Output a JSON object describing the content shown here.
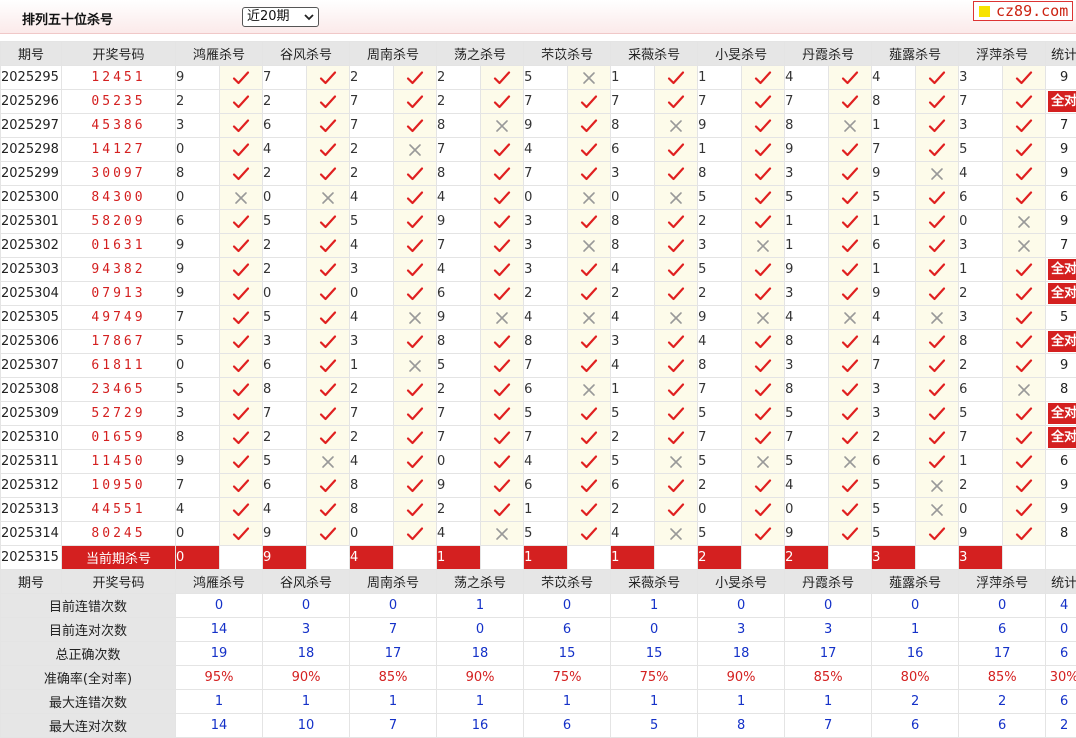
{
  "header": {
    "title": "排列五十位杀号",
    "period_select": "近20期",
    "logo": "cz89.com"
  },
  "columns": {
    "issue": "期号",
    "numbers": "开奖号码",
    "experts": [
      "鸿雁杀号",
      "谷风杀号",
      "周南杀号",
      "荡之杀号",
      "芣苡杀号",
      "采薇杀号",
      "小旻杀号",
      "丹霞杀号",
      "薤露杀号",
      "浮萍杀号"
    ],
    "stat": "统计"
  },
  "rows": [
    {
      "issue": "2025295",
      "numbers": "12451",
      "picks": [
        [
          9,
          1
        ],
        [
          7,
          1
        ],
        [
          2,
          1
        ],
        [
          2,
          1
        ],
        [
          5,
          0
        ],
        [
          1,
          1
        ],
        [
          1,
          1
        ],
        [
          4,
          1
        ],
        [
          4,
          1
        ],
        [
          3,
          1
        ]
      ],
      "stat": "9"
    },
    {
      "issue": "2025296",
      "numbers": "05235",
      "picks": [
        [
          2,
          1
        ],
        [
          2,
          1
        ],
        [
          7,
          1
        ],
        [
          2,
          1
        ],
        [
          7,
          1
        ],
        [
          7,
          1
        ],
        [
          7,
          1
        ],
        [
          7,
          1
        ],
        [
          8,
          1
        ],
        [
          7,
          1
        ]
      ],
      "stat": "全对"
    },
    {
      "issue": "2025297",
      "numbers": "45386",
      "picks": [
        [
          3,
          1
        ],
        [
          6,
          1
        ],
        [
          7,
          1
        ],
        [
          8,
          0
        ],
        [
          9,
          1
        ],
        [
          8,
          0
        ],
        [
          9,
          1
        ],
        [
          8,
          0
        ],
        [
          1,
          1
        ],
        [
          3,
          1
        ]
      ],
      "stat": "7"
    },
    {
      "issue": "2025298",
      "numbers": "14127",
      "picks": [
        [
          0,
          1
        ],
        [
          4,
          1
        ],
        [
          2,
          0
        ],
        [
          7,
          1
        ],
        [
          4,
          1
        ],
        [
          6,
          1
        ],
        [
          1,
          1
        ],
        [
          9,
          1
        ],
        [
          7,
          1
        ],
        [
          5,
          1
        ]
      ],
      "stat": "9"
    },
    {
      "issue": "2025299",
      "numbers": "30097",
      "picks": [
        [
          8,
          1
        ],
        [
          2,
          1
        ],
        [
          2,
          1
        ],
        [
          8,
          1
        ],
        [
          7,
          1
        ],
        [
          3,
          1
        ],
        [
          8,
          1
        ],
        [
          3,
          1
        ],
        [
          9,
          0
        ],
        [
          4,
          1
        ]
      ],
      "stat": "9"
    },
    {
      "issue": "2025300",
      "numbers": "84300",
      "picks": [
        [
          0,
          0
        ],
        [
          0,
          0
        ],
        [
          4,
          1
        ],
        [
          4,
          1
        ],
        [
          0,
          0
        ],
        [
          0,
          0
        ],
        [
          5,
          1
        ],
        [
          5,
          1
        ],
        [
          5,
          1
        ],
        [
          6,
          1
        ]
      ],
      "stat": "6"
    },
    {
      "issue": "2025301",
      "numbers": "58209",
      "picks": [
        [
          6,
          1
        ],
        [
          5,
          1
        ],
        [
          5,
          1
        ],
        [
          9,
          1
        ],
        [
          3,
          1
        ],
        [
          8,
          1
        ],
        [
          2,
          1
        ],
        [
          1,
          1
        ],
        [
          1,
          1
        ],
        [
          0,
          0
        ]
      ],
      "stat": "9"
    },
    {
      "issue": "2025302",
      "numbers": "01631",
      "picks": [
        [
          9,
          1
        ],
        [
          2,
          1
        ],
        [
          4,
          1
        ],
        [
          7,
          1
        ],
        [
          3,
          0
        ],
        [
          8,
          1
        ],
        [
          3,
          0
        ],
        [
          1,
          1
        ],
        [
          6,
          1
        ],
        [
          3,
          0
        ]
      ],
      "stat": "7"
    },
    {
      "issue": "2025303",
      "numbers": "94382",
      "picks": [
        [
          9,
          1
        ],
        [
          2,
          1
        ],
        [
          3,
          1
        ],
        [
          4,
          1
        ],
        [
          3,
          1
        ],
        [
          4,
          1
        ],
        [
          5,
          1
        ],
        [
          9,
          1
        ],
        [
          1,
          1
        ],
        [
          1,
          1
        ]
      ],
      "stat": "全对"
    },
    {
      "issue": "2025304",
      "numbers": "07913",
      "picks": [
        [
          9,
          1
        ],
        [
          0,
          1
        ],
        [
          0,
          1
        ],
        [
          6,
          1
        ],
        [
          2,
          1
        ],
        [
          2,
          1
        ],
        [
          2,
          1
        ],
        [
          3,
          1
        ],
        [
          9,
          1
        ],
        [
          2,
          1
        ]
      ],
      "stat": "全对"
    },
    {
      "issue": "2025305",
      "numbers": "49749",
      "picks": [
        [
          7,
          1
        ],
        [
          5,
          1
        ],
        [
          4,
          0
        ],
        [
          9,
          0
        ],
        [
          4,
          0
        ],
        [
          4,
          0
        ],
        [
          9,
          0
        ],
        [
          4,
          0
        ],
        [
          4,
          0
        ],
        [
          3,
          1
        ]
      ],
      "stat": "5"
    },
    {
      "issue": "2025306",
      "numbers": "17867",
      "picks": [
        [
          5,
          1
        ],
        [
          3,
          1
        ],
        [
          3,
          1
        ],
        [
          8,
          1
        ],
        [
          8,
          1
        ],
        [
          3,
          1
        ],
        [
          4,
          1
        ],
        [
          8,
          1
        ],
        [
          4,
          1
        ],
        [
          8,
          1
        ]
      ],
      "stat": "全对"
    },
    {
      "issue": "2025307",
      "numbers": "61811",
      "picks": [
        [
          0,
          1
        ],
        [
          6,
          1
        ],
        [
          1,
          0
        ],
        [
          5,
          1
        ],
        [
          7,
          1
        ],
        [
          4,
          1
        ],
        [
          8,
          1
        ],
        [
          3,
          1
        ],
        [
          7,
          1
        ],
        [
          2,
          1
        ]
      ],
      "stat": "9"
    },
    {
      "issue": "2025308",
      "numbers": "23465",
      "picks": [
        [
          5,
          1
        ],
        [
          8,
          1
        ],
        [
          2,
          1
        ],
        [
          2,
          1
        ],
        [
          6,
          0
        ],
        [
          1,
          1
        ],
        [
          7,
          1
        ],
        [
          8,
          1
        ],
        [
          3,
          1
        ],
        [
          6,
          0
        ]
      ],
      "stat": "8"
    },
    {
      "issue": "2025309",
      "numbers": "52729",
      "picks": [
        [
          3,
          1
        ],
        [
          7,
          1
        ],
        [
          7,
          1
        ],
        [
          7,
          1
        ],
        [
          5,
          1
        ],
        [
          5,
          1
        ],
        [
          5,
          1
        ],
        [
          5,
          1
        ],
        [
          3,
          1
        ],
        [
          5,
          1
        ]
      ],
      "stat": "全对"
    },
    {
      "issue": "2025310",
      "numbers": "01659",
      "picks": [
        [
          8,
          1
        ],
        [
          2,
          1
        ],
        [
          2,
          1
        ],
        [
          7,
          1
        ],
        [
          7,
          1
        ],
        [
          2,
          1
        ],
        [
          7,
          1
        ],
        [
          7,
          1
        ],
        [
          2,
          1
        ],
        [
          7,
          1
        ]
      ],
      "stat": "全对"
    },
    {
      "issue": "2025311",
      "numbers": "11450",
      "picks": [
        [
          9,
          1
        ],
        [
          5,
          0
        ],
        [
          4,
          1
        ],
        [
          0,
          1
        ],
        [
          4,
          1
        ],
        [
          5,
          0
        ],
        [
          5,
          0
        ],
        [
          5,
          0
        ],
        [
          6,
          1
        ],
        [
          1,
          1
        ]
      ],
      "stat": "6"
    },
    {
      "issue": "2025312",
      "numbers": "10950",
      "picks": [
        [
          7,
          1
        ],
        [
          6,
          1
        ],
        [
          8,
          1
        ],
        [
          9,
          1
        ],
        [
          6,
          1
        ],
        [
          6,
          1
        ],
        [
          2,
          1
        ],
        [
          4,
          1
        ],
        [
          5,
          0
        ],
        [
          2,
          1
        ]
      ],
      "stat": "9"
    },
    {
      "issue": "2025313",
      "numbers": "44551",
      "picks": [
        [
          4,
          1
        ],
        [
          4,
          1
        ],
        [
          8,
          1
        ],
        [
          2,
          1
        ],
        [
          1,
          1
        ],
        [
          2,
          1
        ],
        [
          0,
          1
        ],
        [
          0,
          1
        ],
        [
          5,
          0
        ],
        [
          0,
          1
        ]
      ],
      "stat": "9"
    },
    {
      "issue": "2025314",
      "numbers": "80245",
      "picks": [
        [
          0,
          1
        ],
        [
          9,
          1
        ],
        [
          0,
          1
        ],
        [
          4,
          0
        ],
        [
          5,
          1
        ],
        [
          4,
          0
        ],
        [
          5,
          1
        ],
        [
          9,
          1
        ],
        [
          5,
          1
        ],
        [
          9,
          1
        ]
      ],
      "stat": "8"
    }
  ],
  "current": {
    "issue": "2025315",
    "label": "当前期杀号",
    "picks": [
      "0",
      "9",
      "4",
      "1",
      "1",
      "1",
      "2",
      "2",
      "3",
      "3"
    ]
  },
  "summary": [
    {
      "label": "目前连错次数",
      "values": [
        "0",
        "0",
        "0",
        "1",
        "0",
        "1",
        "0",
        "0",
        "0",
        "0",
        "4"
      ],
      "color": "blue"
    },
    {
      "label": "目前连对次数",
      "values": [
        "14",
        "3",
        "7",
        "0",
        "6",
        "0",
        "3",
        "3",
        "1",
        "6",
        "0"
      ],
      "color": "blue"
    },
    {
      "label": "总正确次数",
      "values": [
        "19",
        "18",
        "17",
        "18",
        "15",
        "15",
        "18",
        "17",
        "16",
        "17",
        "6"
      ],
      "color": "blue"
    },
    {
      "label": "准确率(全对率)",
      "values": [
        "95%",
        "90%",
        "85%",
        "90%",
        "75%",
        "75%",
        "90%",
        "85%",
        "80%",
        "85%",
        "30%"
      ],
      "color": "red"
    },
    {
      "label": "最大连错次数",
      "values": [
        "1",
        "1",
        "1",
        "1",
        "1",
        "1",
        "1",
        "1",
        "2",
        "2",
        "6"
      ],
      "color": "blue"
    },
    {
      "label": "最大连对次数",
      "values": [
        "14",
        "10",
        "7",
        "16",
        "6",
        "5",
        "8",
        "7",
        "6",
        "6",
        "2"
      ],
      "color": "blue"
    }
  ],
  "colors": {
    "accent_red": "#d42020",
    "summary_blue": "#1431c8",
    "header_gray": "#e6e6e6",
    "mark_bg": "#fdfbea",
    "check": "#e02020",
    "cross": "#999999"
  },
  "icons": {
    "correct": "check-icon",
    "wrong": "cross-icon"
  }
}
